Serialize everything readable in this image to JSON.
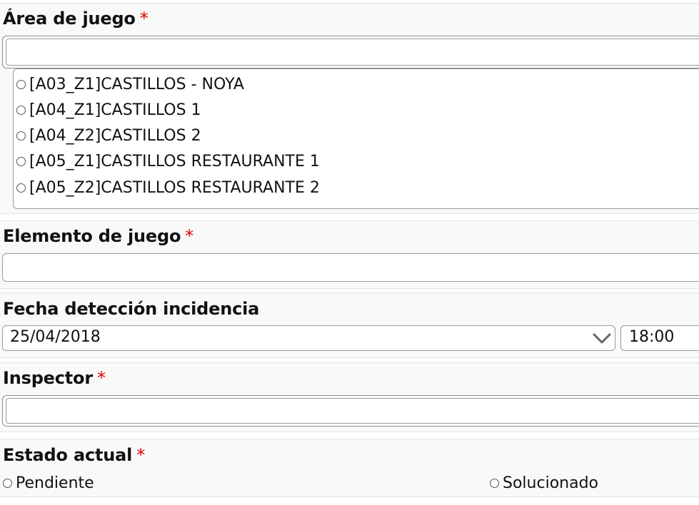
{
  "area": {
    "label": "Área de juego",
    "required_mark": "*",
    "search_value": "",
    "options": [
      {
        "label": "[A03_Z1]CASTILLOS - NOYA",
        "selected": false
      },
      {
        "label": "[A04_Z1]CASTILLOS 1",
        "selected": false
      },
      {
        "label": "[A04_Z2]CASTILLOS 2",
        "selected": false
      },
      {
        "label": "[A05_Z1]CASTILLOS RESTAURANTE 1",
        "selected": false
      },
      {
        "label": "[A05_Z2]CASTILLOS RESTAURANTE 2",
        "selected": false
      }
    ]
  },
  "elemento": {
    "label": "Elemento de juego",
    "required_mark": "*",
    "value": ""
  },
  "fecha": {
    "label": "Fecha detección incidencia",
    "date_value": "25/04/2018",
    "time_value": "18:00"
  },
  "inspector": {
    "label": "Inspector",
    "required_mark": "*",
    "value": ""
  },
  "estado": {
    "label": "Estado actual",
    "required_mark": "*",
    "options": [
      {
        "label": "Pendiente",
        "selected": false
      },
      {
        "label": "Solucionado",
        "selected": false
      }
    ]
  },
  "colors": {
    "required": "#e00000",
    "section_bg": "#f9f9f9",
    "border": "#9a9a9a"
  }
}
